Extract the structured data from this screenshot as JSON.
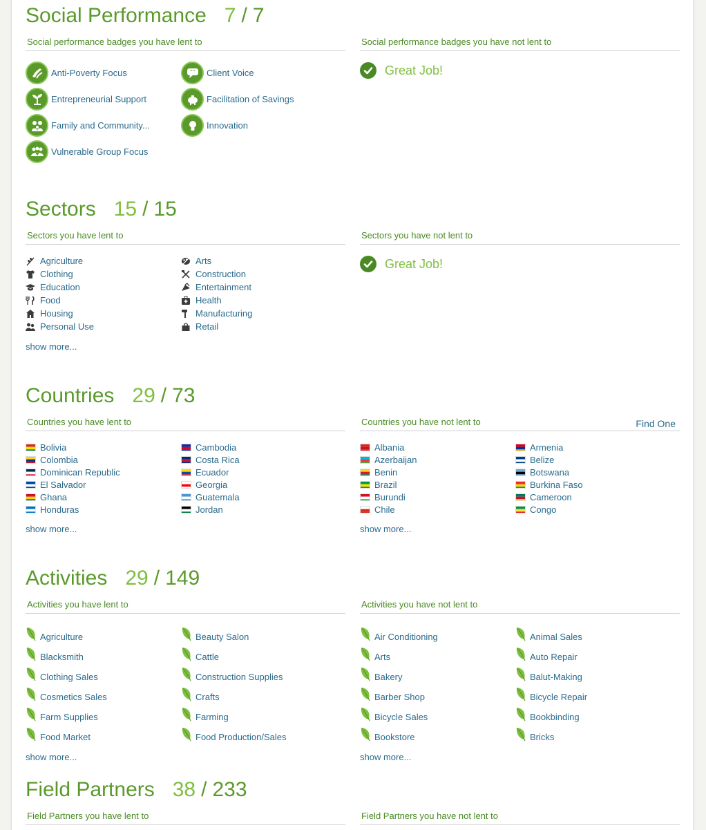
{
  "social": {
    "title": "Social Performance",
    "count": "7",
    "sep": "/",
    "total": "7",
    "left_head": "Social performance badges you have lent to",
    "right_head": "Social performance badges you have not lent to",
    "great": "Great Job!",
    "badges": [
      {
        "label": "Anti-Poverty Focus",
        "icon": "hands-icon"
      },
      {
        "label": "Client Voice",
        "icon": "speech-icon"
      },
      {
        "label": "Entrepreneurial Support",
        "icon": "sprout-icon"
      },
      {
        "label": "Facilitation of Savings",
        "icon": "piggy-bank-icon"
      },
      {
        "label": "Family and Community...",
        "icon": "family-icon"
      },
      {
        "label": "Innovation",
        "icon": "lightbulb-icon"
      },
      {
        "label": "Vulnerable Group Focus",
        "icon": "group-icon"
      }
    ]
  },
  "sectors": {
    "title": "Sectors",
    "count": "15",
    "sep": "/",
    "total": "15",
    "left_head": "Sectors you have lent to",
    "right_head": "Sectors you have not lent to",
    "great": "Great Job!",
    "show_more": "show more...",
    "items": [
      {
        "label": "Agriculture",
        "icon": "wheat-icon"
      },
      {
        "label": "Arts",
        "icon": "palette-icon"
      },
      {
        "label": "Clothing",
        "icon": "shirt-icon"
      },
      {
        "label": "Construction",
        "icon": "tools-icon"
      },
      {
        "label": "Education",
        "icon": "mortarboard-icon"
      },
      {
        "label": "Entertainment",
        "icon": "clapper-icon"
      },
      {
        "label": "Food",
        "icon": "fork-knife-icon"
      },
      {
        "label": "Health",
        "icon": "medkit-icon"
      },
      {
        "label": "Housing",
        "icon": "house-icon"
      },
      {
        "label": "Manufacturing",
        "icon": "hammer-icon"
      },
      {
        "label": "Personal Use",
        "icon": "people-icon"
      },
      {
        "label": "Retail",
        "icon": "bag-icon"
      }
    ]
  },
  "countries": {
    "title": "Countries",
    "count": "29",
    "sep": "/",
    "total": "73",
    "left_head": "Countries you have lent to",
    "right_head": "Countries you have not lent to",
    "find_one": "Find One",
    "show_more": "show more...",
    "lent": [
      {
        "label": "Bolivia",
        "colors": [
          "#d52b1e",
          "#f9e300",
          "#007934"
        ]
      },
      {
        "label": "Cambodia",
        "colors": [
          "#032ea1",
          "#e00025",
          "#032ea1"
        ]
      },
      {
        "label": "Colombia",
        "colors": [
          "#fcd116",
          "#003893",
          "#ce1126"
        ]
      },
      {
        "label": "Costa Rica",
        "colors": [
          "#002b7f",
          "#ce1126",
          "#002b7f"
        ]
      },
      {
        "label": "Dominican Republic",
        "colors": [
          "#002d62",
          "#ffffff",
          "#ce1126"
        ]
      },
      {
        "label": "Ecuador",
        "colors": [
          "#ffdd00",
          "#034ea2",
          "#ed1c24"
        ]
      },
      {
        "label": "El Salvador",
        "colors": [
          "#0047ab",
          "#ffffff",
          "#0047ab"
        ]
      },
      {
        "label": "Georgia",
        "colors": [
          "#ffffff",
          "#ff0000",
          "#ffffff"
        ]
      },
      {
        "label": "Ghana",
        "colors": [
          "#ce1126",
          "#fcd116",
          "#006b3f"
        ]
      },
      {
        "label": "Guatemala",
        "colors": [
          "#4997d0",
          "#ffffff",
          "#4997d0"
        ]
      },
      {
        "label": "Honduras",
        "colors": [
          "#0073cf",
          "#ffffff",
          "#0073cf"
        ]
      },
      {
        "label": "Jordan",
        "colors": [
          "#000000",
          "#ffffff",
          "#007a3d"
        ]
      }
    ],
    "not_lent": [
      {
        "label": "Albania",
        "colors": [
          "#e41e20",
          "#c0181a",
          "#e41e20"
        ]
      },
      {
        "label": "Armenia",
        "colors": [
          "#d90012",
          "#0033a0",
          "#f2a800"
        ]
      },
      {
        "label": "Azerbaijan",
        "colors": [
          "#00b5e2",
          "#ef3340",
          "#509e2f"
        ]
      },
      {
        "label": "Belize",
        "colors": [
          "#003f87",
          "#ffffff",
          "#003f87"
        ]
      },
      {
        "label": "Benin",
        "colors": [
          "#fcd116",
          "#e8112d",
          "#008751"
        ]
      },
      {
        "label": "Botswana",
        "colors": [
          "#6da9d2",
          "#000000",
          "#6da9d2"
        ]
      },
      {
        "label": "Brazil",
        "colors": [
          "#009c3b",
          "#ffdf00",
          "#009c3b"
        ]
      },
      {
        "label": "Burkina Faso",
        "colors": [
          "#ef2b2d",
          "#fcd116",
          "#009e49"
        ]
      },
      {
        "label": "Burundi",
        "colors": [
          "#ce1126",
          "#ffffff",
          "#1eb53a"
        ]
      },
      {
        "label": "Cameroon",
        "colors": [
          "#007a5e",
          "#ce1126",
          "#fcd116"
        ]
      },
      {
        "label": "Chile",
        "colors": [
          "#ffffff",
          "#d52b1e",
          "#d52b1e"
        ]
      },
      {
        "label": "Congo",
        "colors": [
          "#009543",
          "#fbde4a",
          "#dc241f"
        ]
      }
    ]
  },
  "activities": {
    "title": "Activities",
    "count": "29",
    "sep": "/",
    "total": "149",
    "left_head": "Activities you have lent to",
    "right_head": "Activities you have not lent to",
    "show_more": "show more...",
    "lent": [
      "Agriculture",
      "Beauty Salon",
      "Blacksmith",
      "Cattle",
      "Clothing Sales",
      "Construction Supplies",
      "Cosmetics Sales",
      "Crafts",
      "Farm Supplies",
      "Farming",
      "Food Market",
      "Food Production/Sales"
    ],
    "not_lent": [
      "Air Conditioning",
      "Animal Sales",
      "Arts",
      "Auto Repair",
      "Bakery",
      "Balut-Making",
      "Barber Shop",
      "Bicycle Repair",
      "Bicycle Sales",
      "Bookbinding",
      "Bookstore",
      "Bricks"
    ]
  },
  "partners": {
    "title": "Field Partners",
    "count": "38",
    "sep": "/",
    "total": "233",
    "left_head": "Field Partners you have lent to",
    "right_head": "Field Partners you have not lent to"
  },
  "colors": {
    "accent_green": "#5a9a2a",
    "light_green": "#7fbf3f",
    "link_blue": "#2a6a8c"
  }
}
